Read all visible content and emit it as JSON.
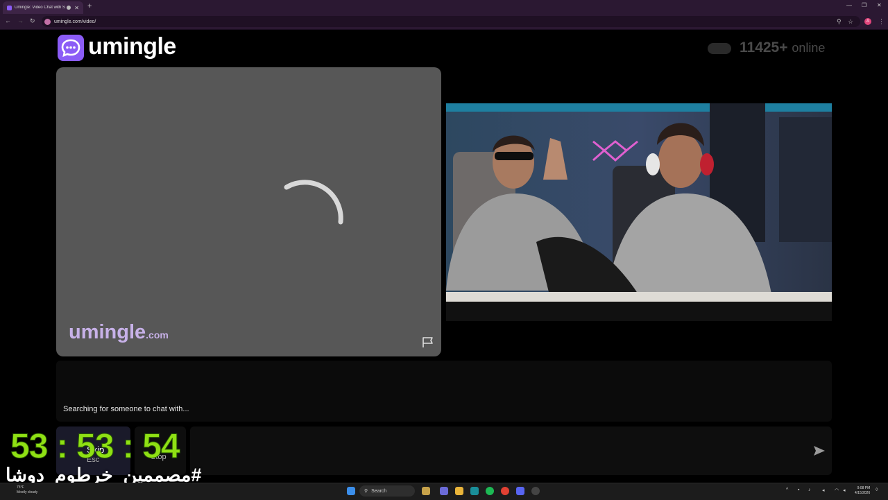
{
  "browser": {
    "tab_title": "Umingle: Video Chat with S",
    "url": "umingle.com/video/",
    "profile_initial": "A"
  },
  "header": {
    "logo_text": "umingle",
    "online_count": "11425+",
    "online_label": "online"
  },
  "stranger_video": {
    "watermark_main": "umingle",
    "watermark_suffix": ".com"
  },
  "chat": {
    "status_message": "Searching for someone to chat with..."
  },
  "controls": {
    "skip_label": "Skip",
    "skip_hint": "Esc",
    "stop_label": "Stop"
  },
  "overlay": {
    "timer": "53 : 53 : 54",
    "hashtag": "#مصممين_خرطوم_دوشا"
  },
  "taskbar": {
    "weather_temp": "75°F",
    "weather_desc": "Mostly cloudy",
    "search_placeholder": "Search",
    "time": "9:08 PM",
    "date": "4/15/2026"
  },
  "colors": {
    "brand": "#8b5cf6",
    "timer": "#8fe014",
    "watermark": "#c7b1e8"
  }
}
